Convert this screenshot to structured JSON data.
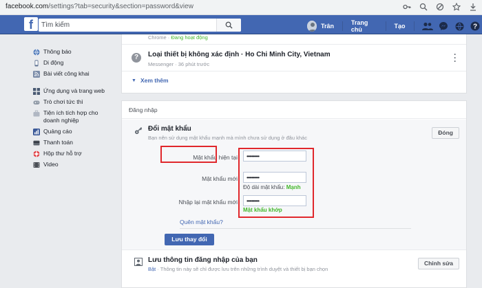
{
  "browser": {
    "url_host": "facebook.com",
    "url_path": "/settings?tab=security&section=password&view",
    "icons": [
      "key-icon",
      "zoom-icon",
      "shield-icon",
      "star-icon",
      "download-icon"
    ]
  },
  "topbar": {
    "logo": "f",
    "search_placeholder": "Tìm kiếm",
    "user_name": "Trân",
    "home": "Trang chủ",
    "create": "Tạo",
    "accent": "#4267b2"
  },
  "sidebar": {
    "groups": [
      [
        {
          "label": "Thông báo",
          "icon": "globe-icon",
          "color": "#4a76b8"
        },
        {
          "label": "Di động",
          "icon": "mobile-icon",
          "color": "#5b6f8f"
        },
        {
          "label": "Bài viết công khai",
          "icon": "rss-icon",
          "color": "#7a8ba8"
        }
      ],
      [
        {
          "label": "Ứng dụng và trang web",
          "icon": "apps-icon",
          "color": "#4a5a73"
        },
        {
          "label": "Trò chơi tức thì",
          "icon": "game-icon",
          "color": "#8f99a6"
        },
        {
          "label": "Tiện ích tích hợp cho doanh nghiệp",
          "icon": "business-icon",
          "color": "#b0b7c3"
        },
        {
          "label": "Quảng cáo",
          "icon": "ads-icon",
          "color": "#3b5998"
        },
        {
          "label": "Thanh toán",
          "icon": "payment-icon",
          "color": "#606770"
        },
        {
          "label": "Hộp thư hỗ trợ",
          "icon": "support-icon",
          "color": "#e0393e"
        },
        {
          "label": "Video",
          "icon": "video-icon",
          "color": "#4b4f56"
        }
      ]
    ]
  },
  "sessions": {
    "prev_device": "Chrome",
    "prev_status": "Đang hoạt động",
    "item_title": "Loại thiết bị không xác định · Ho Chi Minh City, Vietnam",
    "item_sub": "Messenger · 36 phút trước",
    "see_more": "Xem thêm"
  },
  "login": {
    "section_title": "Đăng nhập",
    "change_pw": {
      "title": "Đổi mật khẩu",
      "description": "Bạn nên sử dụng mật khẩu mạnh mà mình chưa sử dụng ở đâu khác",
      "close_label": "Đóng",
      "current_label": "Mật khẩu hiện tại",
      "current_value": "••••••••••",
      "new_label": "Mật khẩu mới",
      "new_value": "••••••••••",
      "strength_prefix": "Độ dài mật khẩu:",
      "strength_value": "Mạnh",
      "confirm_label": "Nhập lại mật khẩu mới",
      "confirm_value": "••••••••••",
      "match_text": "Mật khẩu khớp",
      "forgot": "Quên mật khẩu?",
      "save_label": "Lưu thay đổi",
      "highlight_color": "#e0262b"
    },
    "save_login": {
      "title": "Lưu thông tin đăng nhập của bạn",
      "status": "Bật",
      "description": " · Thông tin này sẽ chỉ được lưu trên những trình duyệt và thiết bị bạn chọn",
      "edit_label": "Chỉnh sửa"
    }
  }
}
